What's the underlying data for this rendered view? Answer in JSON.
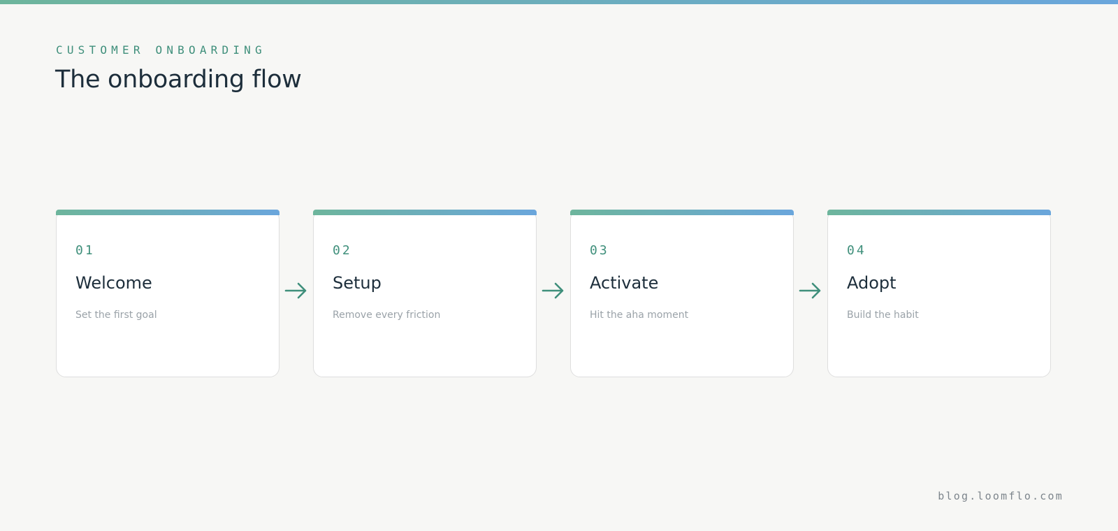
{
  "header": {
    "eyebrow": "CUSTOMER ONBOARDING",
    "title": "The onboarding flow"
  },
  "steps": [
    {
      "number": "01",
      "title": "Welcome",
      "description": "Set the first goal"
    },
    {
      "number": "02",
      "title": "Setup",
      "description": "Remove every friction"
    },
    {
      "number": "03",
      "title": "Activate",
      "description": "Hit the aha moment"
    },
    {
      "number": "04",
      "title": "Adopt",
      "description": "Build the habit"
    }
  ],
  "footer": {
    "url": "blog.loomflo.com"
  },
  "icons": {
    "connector": "arrow-right-icon"
  },
  "colors": {
    "accent_green": "#3f8f7b",
    "gradient_start": "#6db59c",
    "gradient_end": "#6aa6dc",
    "title": "#1d2e3b",
    "description": "#9aa2a8",
    "background": "#f7f7f5"
  }
}
